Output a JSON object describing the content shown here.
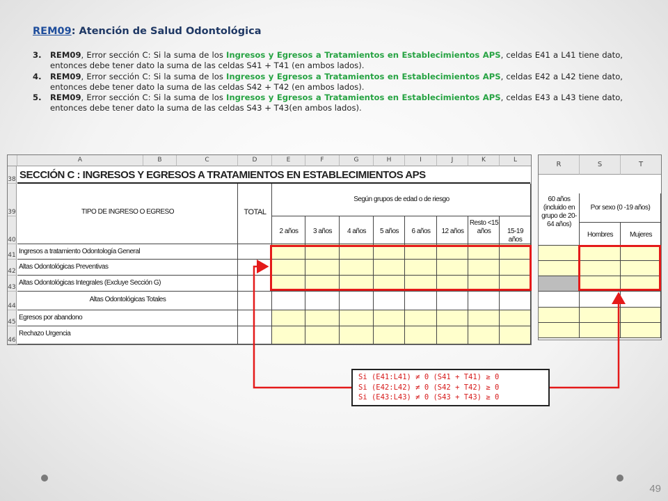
{
  "heading": {
    "code": "REM09",
    "rest": ": Atención de Salud Odontológica"
  },
  "rules": [
    {
      "num": "3.",
      "code": "REM09",
      "pre": ", Error sección C: Si la suma de los ",
      "green": "Ingresos y Egresos a Tratamientos en Establecimientos APS",
      "post": ", celdas E41 a L41 tiene dato, entonces debe tener dato la suma de las celdas S41 + T41 (en ambos lados)."
    },
    {
      "num": "4.",
      "code": "REM09",
      "pre": ", Error sección C: Si la suma de los ",
      "green": "Ingresos y Egresos a Tratamientos en Establecimientos APS",
      "post": ", celdas E42 a L42 tiene dato, entonces debe tener dato la suma de las celdas S42 + T42 (en ambos lados)."
    },
    {
      "num": "5.",
      "code": "REM09",
      "pre": ", Error sección C: Si la suma de los ",
      "green": "Ingresos y Egresos a Tratamientos en Establecimientos APS",
      "post": ", celdas E43 a L43 tiene dato, entonces debe tener dato la suma de las celdas S43 + T43(en ambos lados)."
    }
  ],
  "sheet": {
    "columns": [
      "A",
      "B",
      "C",
      "D",
      "E",
      "F",
      "G",
      "H",
      "I",
      "J",
      "K",
      "L"
    ],
    "row_numbers": [
      "38",
      "39",
      "40",
      "41",
      "42",
      "43",
      "44",
      "45",
      "46"
    ],
    "section_title": "SECCIÓN C : INGRESOS Y EGRESOS A TRATAMIENTOS EN ESTABLECIMIENTOS APS",
    "type_header": "TIPO DE INGRESO O EGRESO",
    "total_header": "TOTAL",
    "group_header": "Según grupos de edad o de riesgo",
    "age_groups": [
      "2 años",
      "3 años",
      "4 años",
      "5 años",
      "6 años",
      "12 años",
      "Resto <15 años",
      "15-19 años"
    ],
    "rows": [
      "Ingresos a tratamiento Odontología General",
      "Altas Odontológicas Preventivas",
      "Altas Odontológicas Integrales (Excluye Sección G)",
      "Altas Odontológicas Totales",
      "Egresos por abandono",
      "Rechazo Urgencia"
    ]
  },
  "sheet2": {
    "columns": [
      "R",
      "S",
      "T"
    ],
    "r_header": "60 años (incluido en grupo de 20-64 años)",
    "sex_header": "Por sexo (0 -19 años)",
    "men": "Hombres",
    "women": "Mujeres"
  },
  "formula": [
    "Si (E41:L41) ≠ 0  (S41 + T41) ≥ 0",
    "Si (E42:L42) ≠ 0  (S42 + T42) ≥ 0",
    "Si (E43:L43) ≠ 0  (S43 + T43) ≥ 0"
  ],
  "colors": {
    "highlight": "#e41a1a",
    "green_text": "#27a343",
    "cell_yellow": "#ffffcc"
  },
  "page_number": "49"
}
